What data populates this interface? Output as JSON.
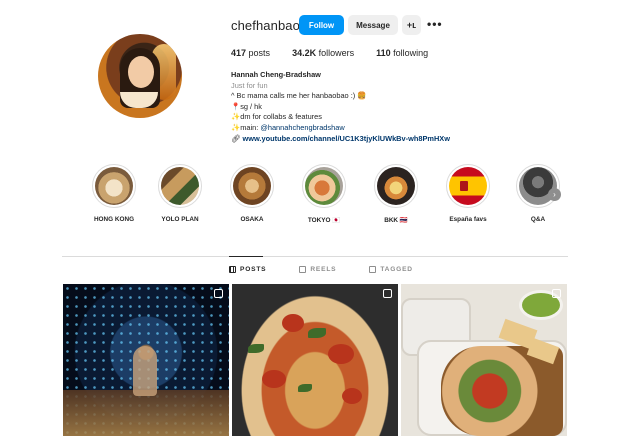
{
  "profile": {
    "username": "chefhanbao",
    "follow_label": "Follow",
    "message_label": "Message",
    "adduser_glyph": "+ʟ",
    "more_glyph": "•••",
    "stats": {
      "posts_count": "417",
      "posts_label": "posts",
      "followers_count": "34.2K",
      "followers_label": "followers",
      "following_count": "110",
      "following_label": "following"
    },
    "bio": {
      "name": "Hannah Cheng-Bradshaw",
      "category": "Just for fun",
      "line1": "^ Bc mama calls me her hanbaobao :) 🍔",
      "line2": "📍sg / hk",
      "line3": "✨dm for collabs & features",
      "line4_prefix": "✨main: ",
      "line4_mention": "@hannahchengbradshaw",
      "link": "www.youtube.com/channel/UC1K3tjyKlUWkBv-wh8PmHXw"
    }
  },
  "highlights": [
    {
      "label": "HONG KONG"
    },
    {
      "label": "YOLO PLAN"
    },
    {
      "label": "OSAKA"
    },
    {
      "label": "TOKYO 🇯🇵"
    },
    {
      "label": "BKK 🇹🇭"
    },
    {
      "label": "España favs"
    },
    {
      "label": "Q&A"
    }
  ],
  "tabs": [
    {
      "label": "POSTS",
      "active": true
    },
    {
      "label": "REELS",
      "active": false
    },
    {
      "label": "TAGGED",
      "active": false
    }
  ],
  "colors": {
    "follow": "#0095f6",
    "text": "#262626",
    "muted": "#8e8e8e",
    "link": "#00376b"
  }
}
